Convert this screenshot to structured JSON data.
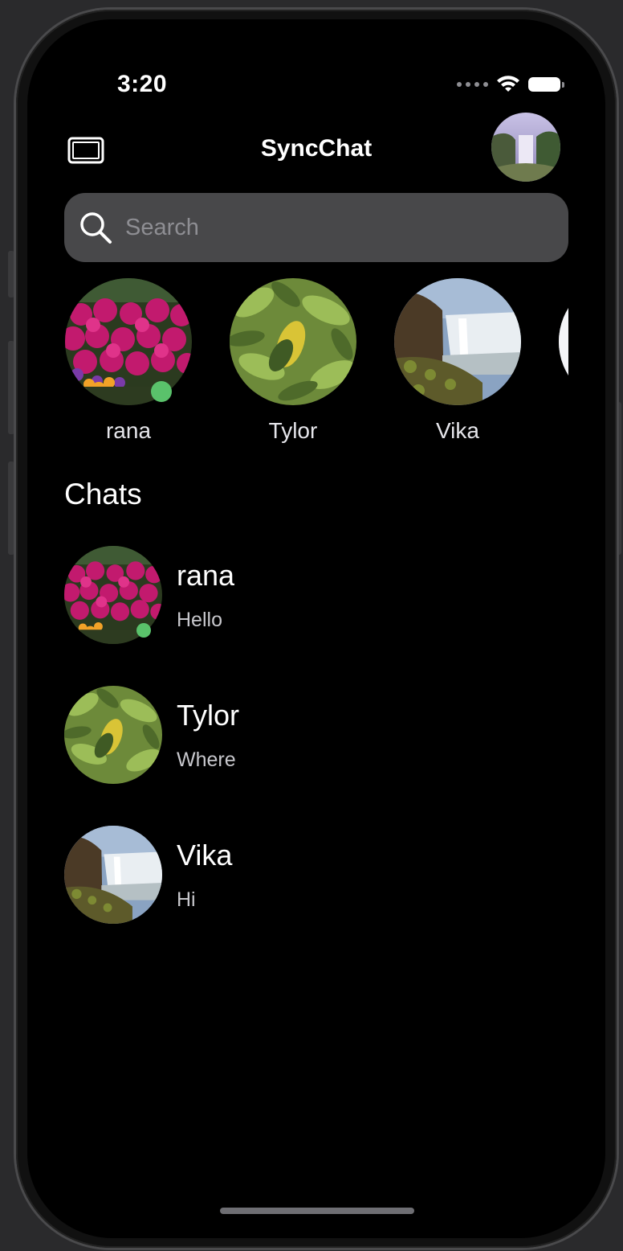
{
  "status_bar": {
    "time": "3:20"
  },
  "nav": {
    "title": "SyncChat",
    "sidebar_icon": "sidebar-toggle-icon",
    "profile_icon": "profile-avatar"
  },
  "search": {
    "placeholder": "Search",
    "value": ""
  },
  "stories": [
    {
      "name": "rana",
      "online": true,
      "photo": "pink-flowers"
    },
    {
      "name": "Tylor",
      "online": false,
      "photo": "green-leaves"
    },
    {
      "name": "Vika",
      "online": false,
      "photo": "waterfall"
    }
  ],
  "chats": {
    "section_title": "Chats",
    "items": [
      {
        "name": "rana",
        "last_message": "Hello",
        "online": true,
        "photo": "pink-flowers"
      },
      {
        "name": "Tylor",
        "last_message": "Where",
        "online": false,
        "photo": "green-leaves"
      },
      {
        "name": "Vika",
        "last_message": "Hi",
        "online": false,
        "photo": "waterfall"
      }
    ]
  },
  "colors": {
    "background": "#000000",
    "search_bg": "#48484a",
    "online": "#5ac26b",
    "text_primary": "#ffffff",
    "text_secondary": "#c7c7cc"
  }
}
